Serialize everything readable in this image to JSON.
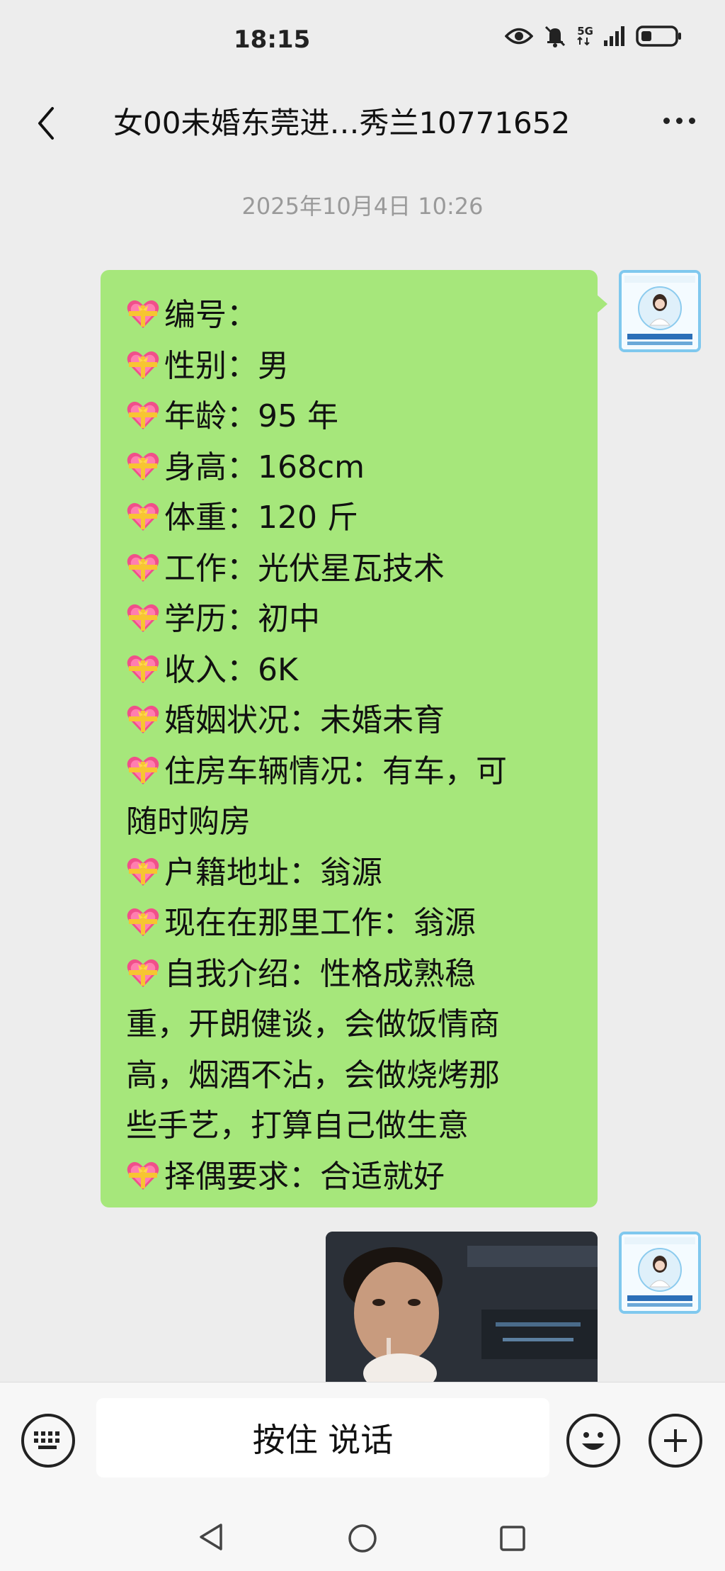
{
  "status_bar": {
    "time": "18:15",
    "network": "5G",
    "icons": [
      "eye-icon",
      "mute-bell-icon",
      "signal-icon",
      "battery-icon"
    ]
  },
  "header": {
    "title": "女00未婚东莞进…秀兰10771652",
    "back_icon": "chevron-left-icon",
    "more_icon": "more-dots-icon"
  },
  "chat": {
    "timestamp": "2025年10月4日 10:26",
    "message_lines": [
      {
        "heart": true,
        "text": "编号："
      },
      {
        "heart": true,
        "text": "性别：男"
      },
      {
        "heart": true,
        "text": "年龄：95 年"
      },
      {
        "heart": true,
        "text": "身高：168cm"
      },
      {
        "heart": true,
        "text": "体重：120 斤"
      },
      {
        "heart": true,
        "text": "工作：光伏星瓦技术"
      },
      {
        "heart": true,
        "text": "学历：初中"
      },
      {
        "heart": true,
        "text": "收入：6K"
      },
      {
        "heart": true,
        "text": "婚姻状况：未婚未育"
      },
      {
        "heart": true,
        "text": "住房车辆情况：有车，可"
      },
      {
        "heart": false,
        "text": "随时购房"
      },
      {
        "heart": true,
        "text": "户籍地址：翁源"
      },
      {
        "heart": true,
        "text": "现在在那里工作：翁源"
      },
      {
        "heart": true,
        "text": "自我介绍：性格成熟稳"
      },
      {
        "heart": false,
        "text": "重，开朗健谈，会做饭情商"
      },
      {
        "heart": false,
        "text": "高，烟酒不沾，会做烧烤那"
      },
      {
        "heart": false,
        "text": "些手艺，打算自己做生意"
      },
      {
        "heart": true,
        "text": "择偶要求：合适就好"
      }
    ],
    "bubble_color": "#a6e77b"
  },
  "input_bar": {
    "voice_label": "按住 说话",
    "keyboard_icon": "keyboard-icon",
    "emoji_icon": "emoji-icon",
    "plus_icon": "plus-icon"
  },
  "system_nav": {
    "icons": [
      "nav-back-icon",
      "nav-home-icon",
      "nav-recents-icon"
    ]
  }
}
